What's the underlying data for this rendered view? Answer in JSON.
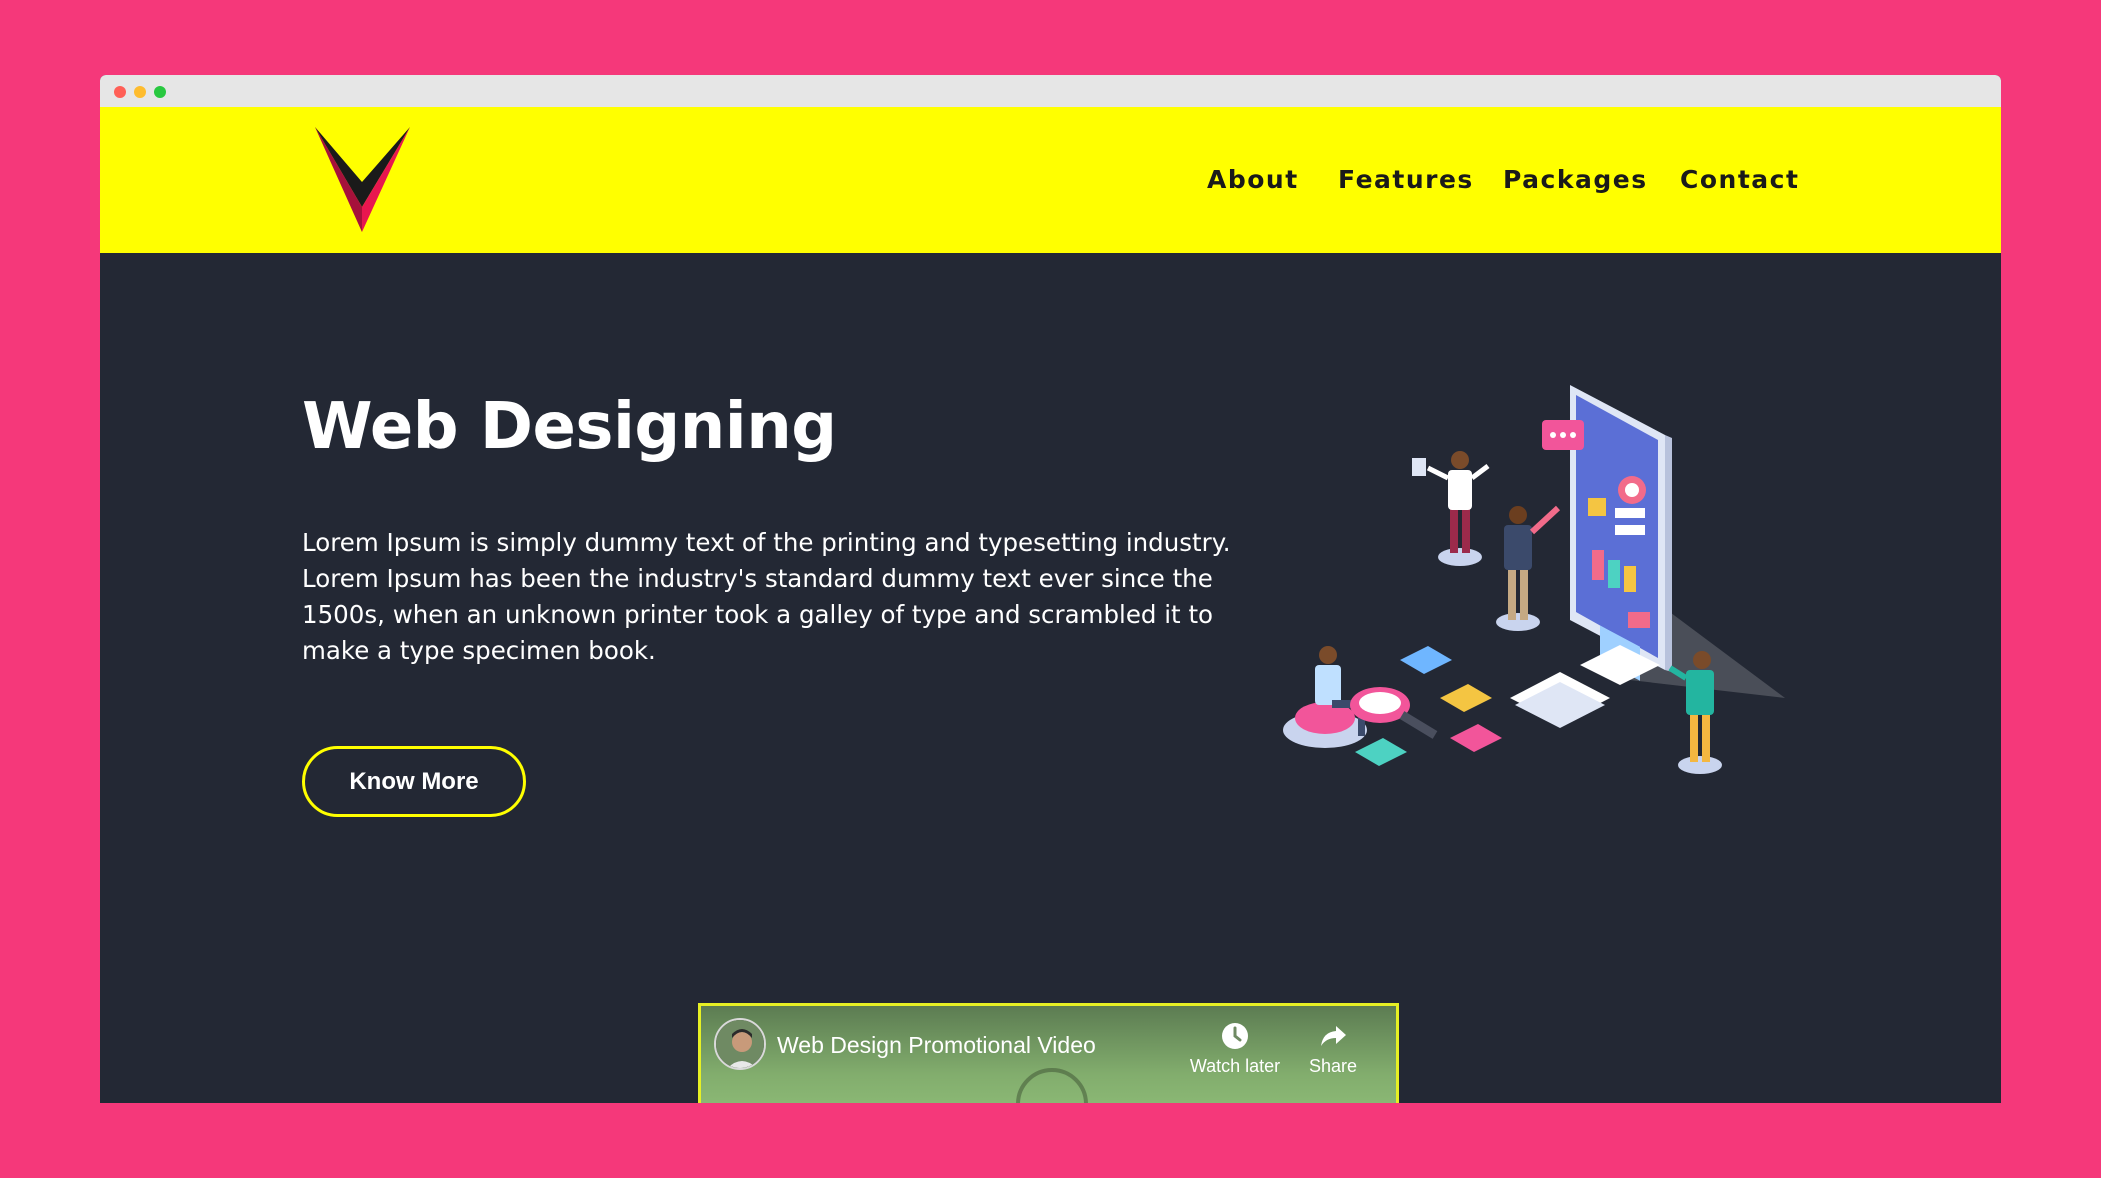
{
  "nav": {
    "items": [
      "About",
      "Features",
      "Packages",
      "Contact"
    ]
  },
  "hero": {
    "title": "Web Designing",
    "text": "Lorem Ipsum is simply dummy text of the printing and typesetting industry. Lorem Ipsum has been the industry's standard dummy text ever since the 1500s, when an unknown printer took a galley of type and scrambled it to make a type specimen book.",
    "button_label": "Know More"
  },
  "video": {
    "title": "Web Design Promotional Video",
    "watch_later_label": "Watch later",
    "share_label": "Share"
  },
  "colors": {
    "page_background": "#f5387a",
    "header_background": "#ffff00",
    "hero_background": "#232834",
    "accent": "#ffff00"
  },
  "icons": {
    "logo": "v-chevron-logo",
    "watch_later": "clock-icon",
    "share": "share-arrow-icon"
  }
}
